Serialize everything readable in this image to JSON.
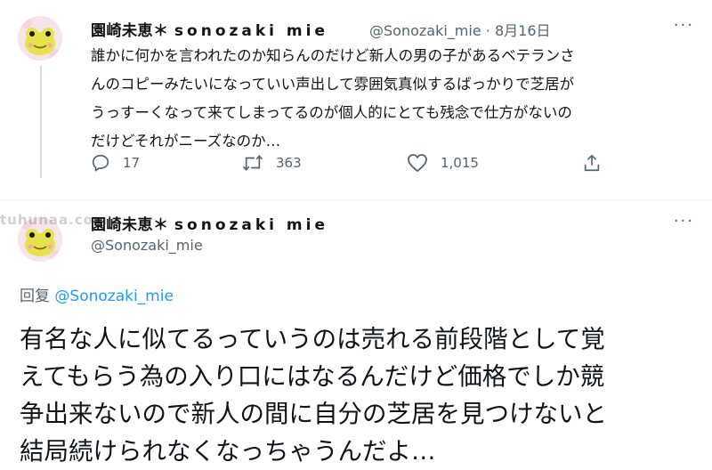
{
  "tweet1": {
    "display_name": "園崎未恵＊",
    "display_name_latin": "sonozaki mie",
    "handle": "@Sonozaki_mie",
    "date_separator": "·",
    "date": "8月16日",
    "text_lines": [
      "誰かに何かを言われたのか知らんのだけど新人の男の子があるベテランさ",
      "んのコピーみたいになっていい声出して雰囲気真似するばっかりで芝居が",
      "うっすーくなって来てしまってるのが個人的にとても残念で仕方がないの",
      "だけどそれがニーズなのか…"
    ],
    "reply_count": "17",
    "retweet_count": "363",
    "like_count": "1,015"
  },
  "tweet2": {
    "display_name": "園崎未恵＊",
    "display_name_latin": "sonozaki mie",
    "handle": "@Sonozaki_mie",
    "reply_label": "回复",
    "reply_mention": "@Sonozaki_mie",
    "text_lines": [
      "有名な人に似てるっていうのは売れる前段階として覚",
      "えてもらう為の入り口にはなるんだけど価格でしか競",
      "争出来ないので新人の間に自分の芝居を見つけないと",
      "結局続けられなくなっちゃうんだよ…"
    ]
  },
  "watermark": "tuhunaa.com",
  "icons": {
    "reply": "reply-icon",
    "retweet": "retweet-icon",
    "like": "heart-icon",
    "share": "share-icon",
    "more": "more-icon",
    "avatar": "avatar-frog-icon"
  },
  "colors": {
    "link": "#1d9bf0",
    "secondary_text": "#536471",
    "primary_text": "#0f1419",
    "thread_line": "#cfd9de"
  }
}
